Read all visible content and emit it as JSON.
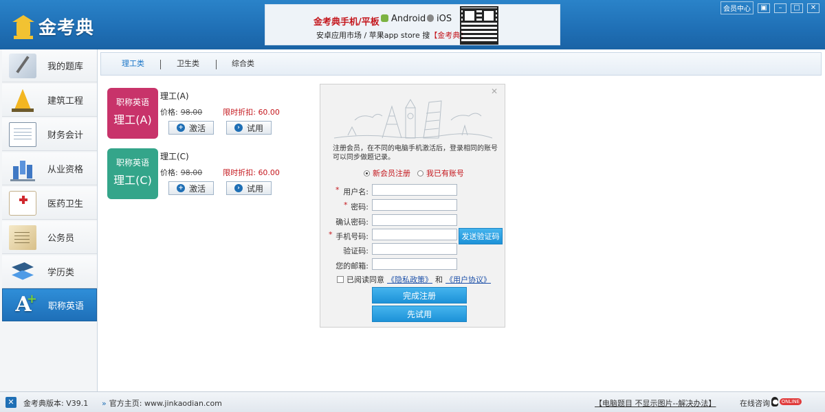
{
  "app": {
    "logo_text": "金考典"
  },
  "banner": {
    "headline": "金考典手机/平板",
    "android": "Android",
    "ios": "iOS",
    "subline_prefix": "安卓应用市场 / 苹果app store 搜",
    "subline_brand": "【金考典】"
  },
  "window": {
    "member_center": "会员中心"
  },
  "sidebar": {
    "items": [
      {
        "label": "我的题库",
        "icon": "notebook-pen-icon"
      },
      {
        "label": "建筑工程",
        "icon": "construction-cone-icon"
      },
      {
        "label": "财务会计",
        "icon": "ledger-icon"
      },
      {
        "label": "从业资格",
        "icon": "bar-chart-icon"
      },
      {
        "label": "医药卫生",
        "icon": "medical-kit-icon"
      },
      {
        "label": "公务员",
        "icon": "document-stack-icon"
      },
      {
        "label": "学历类",
        "icon": "layers-icon"
      },
      {
        "label": "职称英语",
        "icon": "letter-a-plus-icon"
      }
    ],
    "active_index": 7
  },
  "tabs": [
    {
      "label": "理工类",
      "active": true
    },
    {
      "label": "卫生类",
      "active": false
    },
    {
      "label": "综合类",
      "active": false
    }
  ],
  "courses": [
    {
      "card_line1": "职称英语",
      "card_line2": "理工(A)",
      "card_color": "#c8336a",
      "title": "理工(A)",
      "price_label": "价格:",
      "price_old": "98.00",
      "discount_label": "限时折扣:",
      "discount_price": "60.00",
      "activate_label": "激活",
      "trial_label": "试用"
    },
    {
      "card_line1": "职称英语",
      "card_line2": "理工(C)",
      "card_color": "#34a58a",
      "title": "理工(C)",
      "price_label": "价格:",
      "price_old": "98.00",
      "discount_label": "限时折扣:",
      "discount_price": "60.00",
      "activate_label": "激活",
      "trial_label": "试用"
    }
  ],
  "register": {
    "intro": "注册会员，在不同的电脑手机激活后，登录相同的账号可以同步做题记录。",
    "radio_new": "新会员注册",
    "radio_existing": "我已有账号",
    "fields": {
      "username": "用户名:",
      "password": "密码:",
      "confirm_password": "确认密码:",
      "phone": "手机号码:",
      "code": "验证码:",
      "email": "您的邮箱:"
    },
    "send_code": "发送验证码",
    "agree_prefix": "已阅读同意",
    "privacy_link": "《隐私政策》",
    "and": "和",
    "user_agreement_link": "《用户协议》",
    "submit": "完成注册",
    "trial_first": "先试用"
  },
  "statusbar": {
    "version_label": "金考典版本:",
    "version": "V39.1",
    "homepage_label": "官方主页:",
    "homepage_url": "www.jinkaodian.com",
    "fix_link": "【电脑题目 不显示图片--解决办法】",
    "consult": "在线咨询",
    "online_tag": "ONLINE"
  },
  "colors": {
    "accent_blue": "#1f6fb5",
    "discount_red": "#c4161c",
    "button_blue": "#1d92d8"
  }
}
